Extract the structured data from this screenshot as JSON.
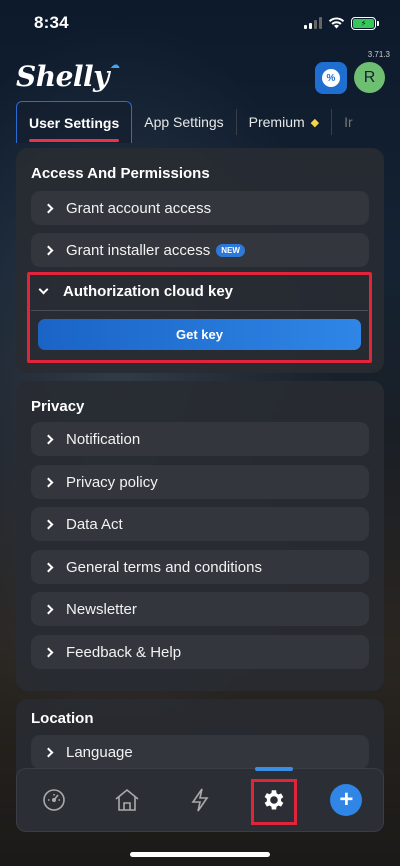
{
  "status_bar": {
    "time": "8:34"
  },
  "header": {
    "logo": "Shelly",
    "version": "3.71.3",
    "avatar_initial": "R",
    "badge_symbol": "%"
  },
  "tabs": [
    {
      "label": "User Settings",
      "active": true
    },
    {
      "label": "App Settings",
      "active": false
    },
    {
      "label": "Premium",
      "active": false
    },
    {
      "label": "Ir",
      "active": false
    }
  ],
  "access": {
    "title": "Access And Permissions",
    "grant_account": "Grant account access",
    "grant_installer": "Grant installer access",
    "new_badge": "NEW",
    "auth_title": "Authorization cloud key",
    "get_key": "Get key"
  },
  "privacy": {
    "title": "Privacy",
    "items": [
      "Notification",
      "Privacy policy",
      "Data Act",
      "General terms and conditions",
      "Newsletter",
      "Feedback & Help"
    ]
  },
  "location": {
    "title": "Location",
    "items": [
      "Language"
    ]
  },
  "colors": {
    "accent": "#2f86e6",
    "highlight": "#e0243a",
    "active_tab_underline": "#e8334a"
  },
  "bottom_nav": {
    "items": [
      "dashboard-icon",
      "home-icon",
      "lightning-icon",
      "gear-icon",
      "plus-icon"
    ],
    "active": "gear-icon"
  }
}
